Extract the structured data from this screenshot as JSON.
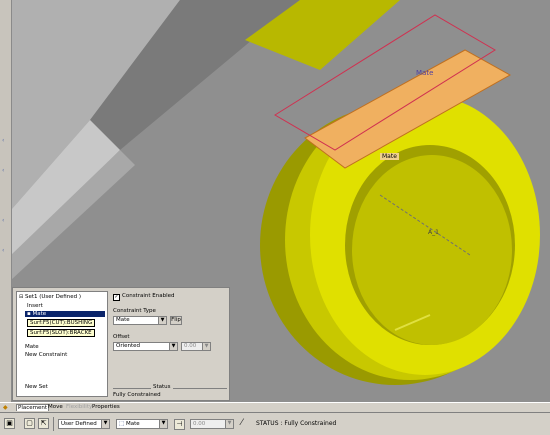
{
  "viewport": {
    "labels": {
      "mate_top": "Mate",
      "mate_middle": "Mate",
      "axis": "A_1"
    }
  },
  "panel": {
    "tree": {
      "set_header": "Set1 (User Defined )",
      "insert": "Insert",
      "mate_selected": "Mate",
      "ref1": "Surf:F5(CUT):BUSHING",
      "ref2": "Surf:F5(SLOT):BRACKE",
      "mate2": "Mate",
      "new_constraint": "New Constraint",
      "new_set": "New Set"
    },
    "constraint_enabled_label": "Constraint Enabled",
    "constraint_type_label": "Constraint Type",
    "constraint_type_value": "Mate",
    "flip_label": "Flip",
    "offset_label": "Offset",
    "offset_value": "Oriented",
    "offset_number": "0.00",
    "status_heading": "Status",
    "status_value": "Fully Constrained"
  },
  "tabs": [
    "Placement",
    "Move",
    "Flexibility",
    "Properties"
  ],
  "statusbar": {
    "connection_type": "User Defined",
    "constraint": "Mate",
    "offset": "0.00",
    "status": "STATUS : Fully Constrained"
  },
  "colors": {
    "viewport_bg": "#8f8f8f",
    "part_yellow": "#d8d800",
    "highlight_orange": "#f0b060",
    "selection_blue": "#0a246a"
  }
}
